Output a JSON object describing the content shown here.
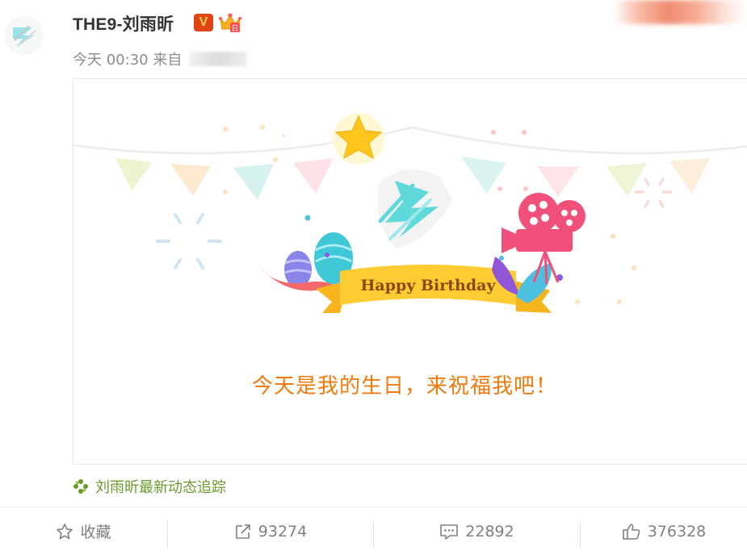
{
  "post": {
    "username": "THE9-刘雨昕",
    "verified_badge": "V",
    "time": "今天 00:30",
    "source_prefix": "来自"
  },
  "card": {
    "banner_text": "Happy Birthday",
    "message": "今天是我的生日，来祝福我吧！"
  },
  "tracker": {
    "label": "刘雨昕最新动态追踪"
  },
  "actions": {
    "favorite_label": "收藏",
    "repost_count": "93274",
    "comment_count": "22892",
    "like_count": "376328"
  },
  "colors": {
    "accent_orange": "#f07a0c",
    "tracker_green": "#6a9b2a",
    "vbadge_red": "#e14415",
    "muted_gray": "#8c8c8c"
  },
  "icons": [
    "avatar-logo-icon",
    "verified-v-icon",
    "crown-icon",
    "star-icon",
    "movie-camera-icon",
    "tracker-flower-icon",
    "star-outline-icon",
    "repost-icon",
    "comment-icon",
    "thumbs-up-icon"
  ]
}
